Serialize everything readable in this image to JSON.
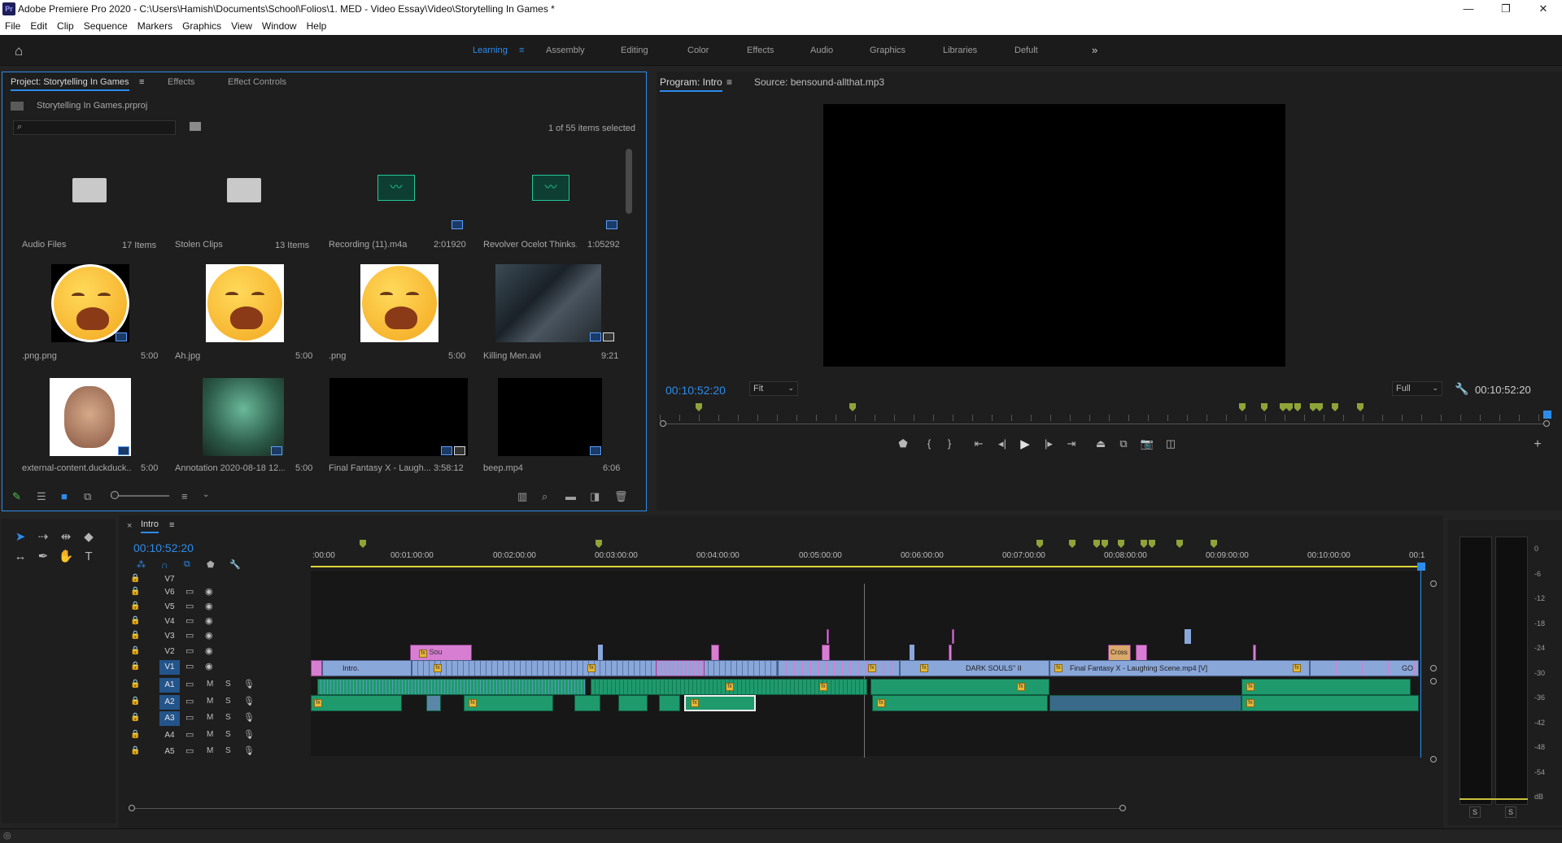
{
  "app": {
    "title": "Adobe Premiere Pro 2020 - C:\\Users\\Hamish\\Documents\\School\\Folios\\1. MED - Video Essay\\Video\\Storytelling In Games *",
    "icon": "Pr"
  },
  "menu": [
    "File",
    "Edit",
    "Clip",
    "Sequence",
    "Markers",
    "Graphics",
    "View",
    "Window",
    "Help"
  ],
  "workspaces": [
    "Learning",
    "Assembly",
    "Editing",
    "Color",
    "Effects",
    "Audio",
    "Graphics",
    "Libraries",
    "Defult"
  ],
  "project": {
    "tabs": [
      "Project: Storytelling In Games",
      "Effects",
      "Effect Controls"
    ],
    "file": "Storytelling In Games.prproj",
    "selection": "1 of 55 items selected",
    "items": [
      {
        "name": "Audio Files",
        "dur": "17 Items",
        "kind": "folder"
      },
      {
        "name": "Stolen Clips",
        "dur": "13 Items",
        "kind": "folder"
      },
      {
        "name": "Recording (11).m4a",
        "dur": "2:01920",
        "kind": "audio"
      },
      {
        "name": "Revolver Ocelot Thinks...",
        "dur": "1:05292",
        "kind": "audio"
      },
      {
        "name": ".png.png",
        "dur": "5:00",
        "kind": "emoji"
      },
      {
        "name": "Ah.jpg",
        "dur": "5:00",
        "kind": "emoji"
      },
      {
        "name": ".png",
        "dur": "5:00",
        "kind": "emoji"
      },
      {
        "name": "Killing Men.avi",
        "dur": "9:21",
        "kind": "video"
      },
      {
        "name": "external-content.duckduck...",
        "dur": "5:00",
        "kind": "face"
      },
      {
        "name": "Annotation 2020-08-18 12...",
        "dur": "5:00",
        "kind": "green"
      },
      {
        "name": "Final Fantasy X - Laugh...",
        "dur": "3:58:12",
        "kind": "black"
      },
      {
        "name": "beep.mp4",
        "dur": "6:06",
        "kind": "black"
      }
    ]
  },
  "program": {
    "tabs": [
      "Program: Intro",
      "Source: bensound-allthat.mp3"
    ],
    "timecode_left": "00:10:52:20",
    "fit": "Fit",
    "quality": "Full",
    "timecode_right": "00:10:52:20"
  },
  "timeline": {
    "sequence": "Intro",
    "timecode": "00:10:52:20",
    "ruler": [
      ":00:00",
      "00:01:00:00",
      "00:02:00:00",
      "00:03:00:00",
      "00:04:00:00",
      "00:05:00:00",
      "00:06:00:00",
      "00:07:00:00",
      "00:08:00:00",
      "00:09:00:00",
      "00:10:00:00",
      "00:1"
    ],
    "video_tracks": [
      "V7",
      "V6",
      "V5",
      "V4",
      "V3",
      "V2",
      "V1"
    ],
    "audio_tracks": [
      "A1",
      "A2",
      "A3",
      "A4",
      "A5"
    ],
    "clip_labels": {
      "intro": "Intro.",
      "sou": "Sou",
      "ds": "DARK SOULS\" II",
      "ff": "Final Fantasy X - Laughing Scene.mp4 [V]",
      "go": "GO",
      "cross": "Cross"
    },
    "ms": [
      "M",
      "S"
    ]
  },
  "meters": {
    "scale": [
      "0",
      "-6",
      "-12",
      "-18",
      "-24",
      "-30",
      "-36",
      "-42",
      "-48",
      "-54",
      "dB"
    ],
    "solo": [
      "S",
      "S"
    ]
  },
  "colors": {
    "accent": "#2d8ceb",
    "video_clip": "#8aa7da",
    "audio_clip": "#1f9a6d",
    "pink_clip": "#d77ed2",
    "marker": "#8fa438",
    "playhead_bar": "#e0d43a"
  }
}
